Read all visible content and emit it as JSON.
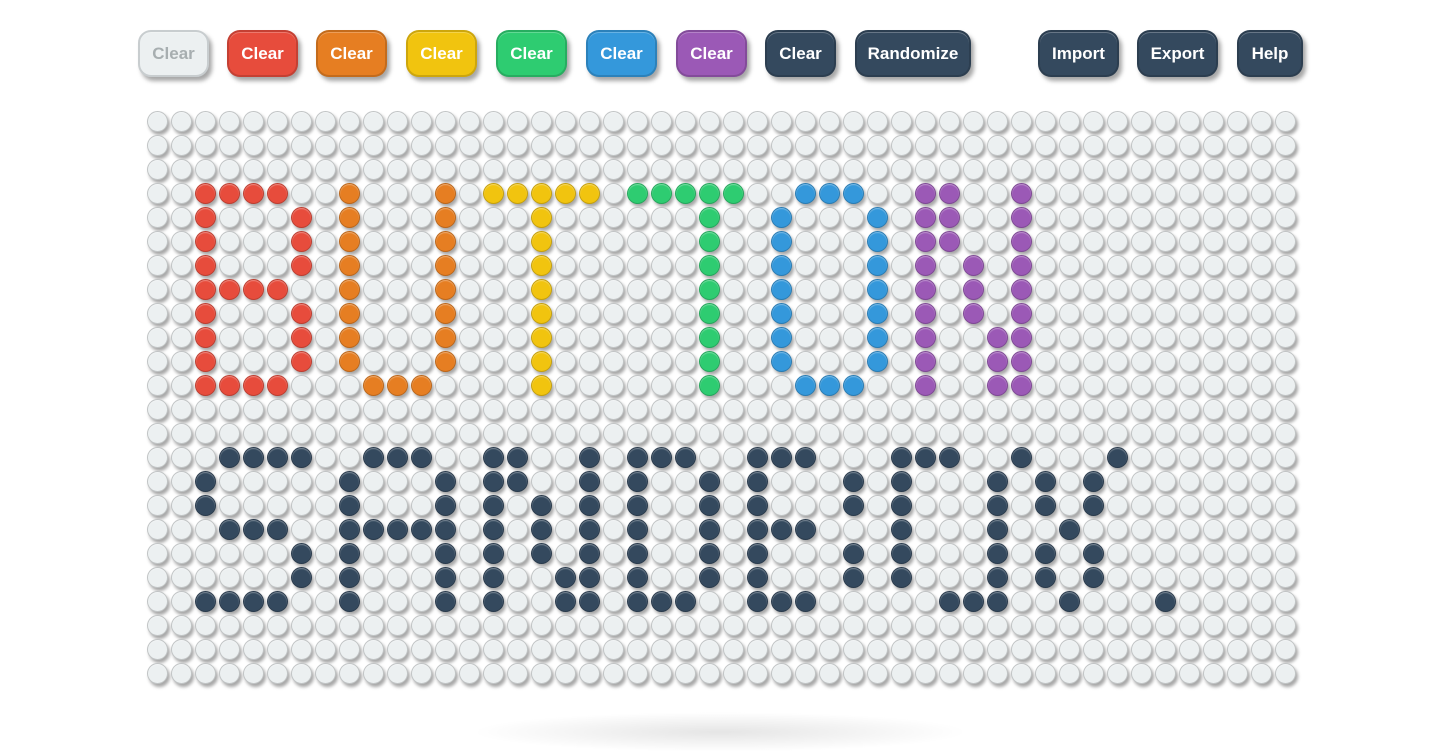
{
  "toolbar": {
    "buttons": [
      {
        "label": "Clear",
        "color": "#ecf0f1",
        "name": "clear-white-button"
      },
      {
        "label": "Clear",
        "color": "#e74c3c",
        "name": "clear-red-button"
      },
      {
        "label": "Clear",
        "color": "#e67e22",
        "name": "clear-orange-button"
      },
      {
        "label": "Clear",
        "color": "#f1c40f",
        "name": "clear-yellow-button"
      },
      {
        "label": "Clear",
        "color": "#2ecc71",
        "name": "clear-green-button"
      },
      {
        "label": "Clear",
        "color": "#3498db",
        "name": "clear-blue-button"
      },
      {
        "label": "Clear",
        "color": "#9b59b6",
        "name": "clear-purple-button"
      },
      {
        "label": "Clear",
        "color": "#34495e",
        "name": "clear-navy-button"
      },
      {
        "label": "Randomize",
        "color": "#34495e",
        "name": "randomize-button"
      },
      {
        "label": "Import",
        "color": "#34495e",
        "name": "import-button"
      },
      {
        "label": "Export",
        "color": "#34495e",
        "name": "export-button"
      },
      {
        "label": "Help",
        "color": "#34495e",
        "name": "help-button"
      }
    ]
  },
  "board": {
    "cols": 48,
    "rows": 24,
    "palette": {
      ".": "#ecf0f1",
      "R": "#e74c3c",
      "O": "#e67e22",
      "Y": "#f1c40f",
      "G": "#2ecc71",
      "B": "#3498db",
      "P": "#9b59b6",
      "N": "#34495e"
    },
    "grid": [
      "................................................",
      "................................................",
      "................................................",
      "..RRRR..O...O.YYYYY.GGGGG..BBB..PP..P...........",
      "..R...R.O...O...Y......G..B...B.PP..P...........",
      "..R...R.O...O...Y......G..B...B.PP..P...........",
      "..R...R.O...O...Y......G..B...B.P.P.P...........",
      "..RRRR..O...O...Y......G..B...B.P.P.P...........",
      "..R...R.O...O...Y......G..B...B.P.P.P...........",
      "..R...R.O...O...Y......G..B...B.P..PP...........",
      "..R...R.O...O...Y......G..B...B.P..PP...........",
      "..RRRR...OOO....Y......G...BBB..P..PP...........",
      "................................................",
      "................................................",
      "...NNNN..NNN..NN..N.NNN..NNN...NNN..N...N.......",
      "..N.....N...N.NN..N.N..N.N...N.N...N.N.N........",
      "..N.....N...N.N.N.N.N..N.N...N.N...N.N.N........",
      "...NNN..NNNNN.N.N.N.N..N.NNN...N...N..N.........",
      "......N.N...N.N.N.N.N..N.N...N.N...N.N.N........",
      "......N.N...N.N..NN.N..N.N...N.N...N.N.N........",
      "..NNNN..N...N.N..NN.NNN..NNN.....NNN..N...N.....",
      "................................................",
      "................................................",
      "................................................"
    ]
  }
}
